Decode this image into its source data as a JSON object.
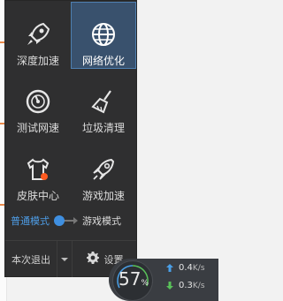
{
  "tiles": [
    {
      "label": "深度加速",
      "icon": "rocket-icon",
      "active": false
    },
    {
      "label": "网络优化",
      "icon": "globe-icon",
      "active": true
    },
    {
      "label": "测试网速",
      "icon": "speedometer-icon",
      "active": false
    },
    {
      "label": "垃圾清理",
      "icon": "broom-icon",
      "active": false
    },
    {
      "label": "皮肤中心",
      "icon": "tshirt-icon",
      "active": false
    },
    {
      "label": "游戏加速",
      "icon": "game-rocket-icon",
      "active": false
    }
  ],
  "mode": {
    "left_label": "普通模式",
    "right_label": "游戏模式"
  },
  "bottom": {
    "exit_label": "本次退出",
    "settings_label": "设置"
  },
  "widget": {
    "percent_value": "57",
    "percent_sign": "%",
    "upload": "0.4",
    "upload_unit": "K/s",
    "download": "0.3",
    "download_unit": "K/s"
  },
  "colors": {
    "panel_bg": "#2f2f30",
    "active_tile": "#39516d",
    "accent_blue": "#3f8fe0",
    "notification_dot": "#ff5a1f",
    "upload_arrow": "#4aa0e8",
    "download_arrow": "#59c159"
  }
}
